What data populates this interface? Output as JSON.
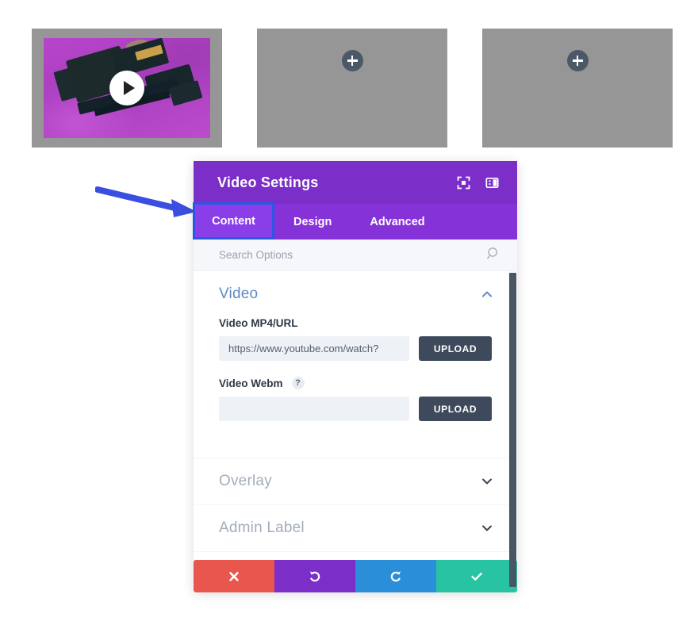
{
  "builder": {
    "modules": [
      {
        "name": "video-module-filled",
        "type": "video",
        "state": "filled",
        "play_icon": "play-icon"
      },
      {
        "name": "video-module-empty-1",
        "type": "placeholder",
        "state": "empty",
        "add_icon": "plus-icon"
      },
      {
        "name": "video-module-empty-2",
        "type": "placeholder",
        "state": "empty",
        "add_icon": "plus-icon"
      }
    ]
  },
  "annotation": {
    "arrow": "arrow-right-icon",
    "color": "#3a4fe0",
    "points_to": "Content"
  },
  "modal": {
    "title": "Video Settings",
    "header_icons": [
      {
        "name": "expand-icon",
        "label": "Expand"
      },
      {
        "name": "layout-panel-icon",
        "label": "Change Layout"
      }
    ],
    "tabs": [
      {
        "label": "Content",
        "active": true,
        "highlighted": true
      },
      {
        "label": "Design",
        "active": false,
        "highlighted": false
      },
      {
        "label": "Advanced",
        "active": false,
        "highlighted": false
      }
    ],
    "search": {
      "placeholder": "Search Options",
      "value": "",
      "icon": "search-icon"
    },
    "sections": [
      {
        "title": "Video",
        "expanded": true,
        "chevron": "chevron-up-icon",
        "fields": [
          {
            "label": "Video MP4/URL",
            "value": "https://www.youtube.com/watch?",
            "placeholder": "",
            "help": false,
            "button": "UPLOAD"
          },
          {
            "label": "Video Webm",
            "value": "",
            "placeholder": "",
            "help": true,
            "help_glyph": "?",
            "button": "UPLOAD"
          }
        ]
      },
      {
        "title": "Overlay",
        "expanded": false,
        "chevron": "chevron-down-icon",
        "fields": []
      },
      {
        "title": "Admin Label",
        "expanded": false,
        "chevron": "chevron-down-icon",
        "fields": []
      }
    ],
    "actions": [
      {
        "name": "cancel-button",
        "icon": "close-icon",
        "glyph": "✖",
        "color": "#e8564d"
      },
      {
        "name": "undo-button",
        "icon": "undo-icon",
        "glyph": "↺",
        "color": "#7b2ec8"
      },
      {
        "name": "redo-button",
        "icon": "redo-icon",
        "glyph": "↻",
        "color": "#2a8fd8"
      },
      {
        "name": "save-button",
        "icon": "checkmark-icon",
        "glyph": "✔",
        "color": "#28c3a3"
      }
    ],
    "scrollbar": {
      "name": "vertical-scrollbar"
    }
  },
  "colors": {
    "header_purple": "#7b2ec8",
    "tabbar_purple": "#8532d9",
    "active_tab_purple": "#8a3ee8",
    "highlight_blue": "#2b58e2",
    "section_open_blue": "#5e8ac8",
    "section_closed_gray": "#a4adba",
    "upload_slate": "#3e4a5c"
  }
}
